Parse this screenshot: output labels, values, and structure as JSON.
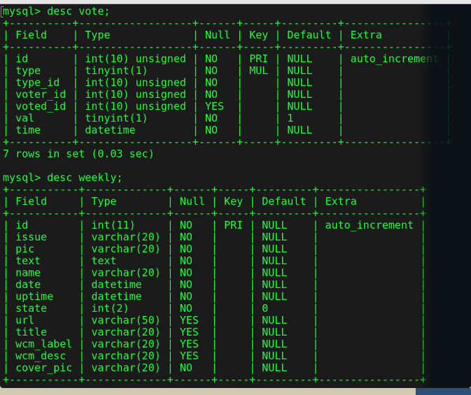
{
  "terminal": {
    "prompt": "mysql>",
    "color_text": "#19ff3c",
    "sessions": [
      {
        "command": "desc vote;",
        "columns": [
          "Field",
          "Type",
          "Null",
          "Key",
          "Default",
          "Extra"
        ],
        "rows": [
          [
            "id",
            "int(10) unsigned",
            "NO",
            "PRI",
            "NULL",
            "auto_increment"
          ],
          [
            "type",
            "tinyint(1)",
            "NO",
            "MUL",
            "NULL",
            ""
          ],
          [
            "type_id",
            "int(10) unsigned",
            "NO",
            "",
            "NULL",
            ""
          ],
          [
            "voter_id",
            "int(10) unsigned",
            "NO",
            "",
            "NULL",
            ""
          ],
          [
            "voted_id",
            "int(10) unsigned",
            "YES",
            "",
            "NULL",
            ""
          ],
          [
            "val",
            "tinyint(1)",
            "NO",
            "",
            "1",
            ""
          ],
          [
            "time",
            "datetime",
            "NO",
            "",
            "NULL",
            ""
          ]
        ],
        "summary": "7 rows in set (0.03 sec)"
      },
      {
        "command": "desc weekly;",
        "columns": [
          "Field",
          "Type",
          "Null",
          "Key",
          "Default",
          "Extra"
        ],
        "rows": [
          [
            "id",
            "int(11)",
            "NO",
            "PRI",
            "NULL",
            "auto_increment"
          ],
          [
            "issue",
            "varchar(20)",
            "NO",
            "",
            "NULL",
            ""
          ],
          [
            "pic",
            "varchar(20)",
            "NO",
            "",
            "NULL",
            ""
          ],
          [
            "text",
            "text",
            "NO",
            "",
            "NULL",
            ""
          ],
          [
            "name",
            "varchar(20)",
            "NO",
            "",
            "NULL",
            ""
          ],
          [
            "date",
            "datetime",
            "NO",
            "",
            "NULL",
            ""
          ],
          [
            "uptime",
            "datetime",
            "NO",
            "",
            "NULL",
            ""
          ],
          [
            "state",
            "int(2)",
            "NO",
            "",
            "0",
            ""
          ],
          [
            "url",
            "varchar(50)",
            "YES",
            "",
            "NULL",
            ""
          ],
          [
            "title",
            "varchar(20)",
            "YES",
            "",
            "NULL",
            ""
          ],
          [
            "wcm_label",
            "varchar(20)",
            "YES",
            "",
            "NULL",
            ""
          ],
          [
            "wcm_desc",
            "varchar(20)",
            "YES",
            "",
            "NULL",
            ""
          ],
          [
            "cover_pic",
            "varchar(20)",
            "NO",
            "",
            "NULL",
            ""
          ]
        ]
      }
    ]
  }
}
